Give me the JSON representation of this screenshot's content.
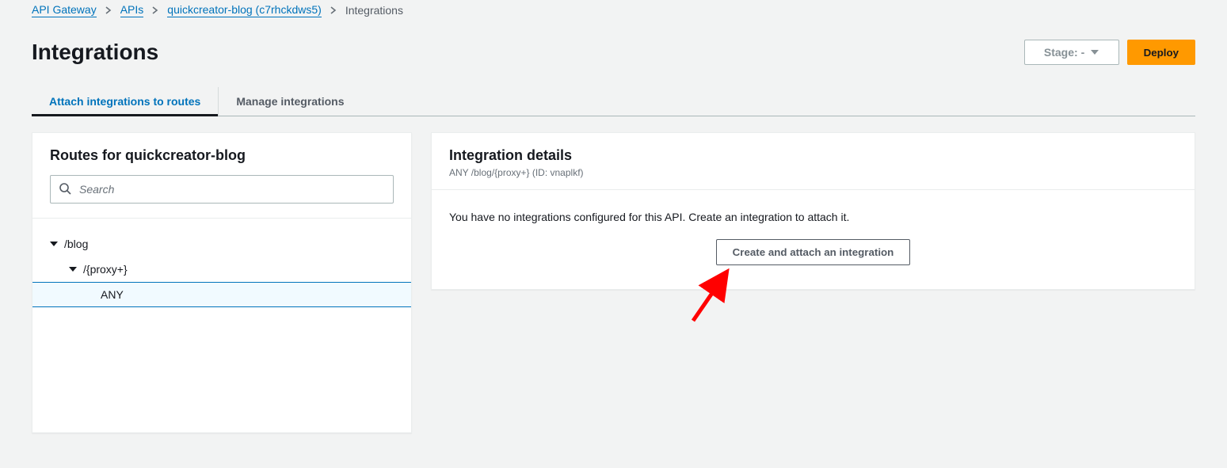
{
  "breadcrumbs": {
    "items": [
      {
        "label": "API Gateway"
      },
      {
        "label": "APIs"
      },
      {
        "label": "quickcreator-blog (c7rhckdws5)"
      }
    ],
    "current": "Integrations"
  },
  "header": {
    "title": "Integrations",
    "stage_label": "Stage: -",
    "deploy_label": "Deploy"
  },
  "tabs": {
    "attach": "Attach integrations to routes",
    "manage": "Manage integrations"
  },
  "routes_panel": {
    "title": "Routes for quickcreator-blog",
    "search_placeholder": "Search",
    "tree": {
      "lvl0": "/blog",
      "lvl1": "/{proxy+}",
      "lvl2": "ANY"
    }
  },
  "details_panel": {
    "title": "Integration details",
    "subtitle": "ANY /blog/{proxy+} (ID: vnaplkf)",
    "empty_message": "You have no integrations configured for this API. Create an integration to attach it.",
    "create_button": "Create and attach an integration"
  }
}
